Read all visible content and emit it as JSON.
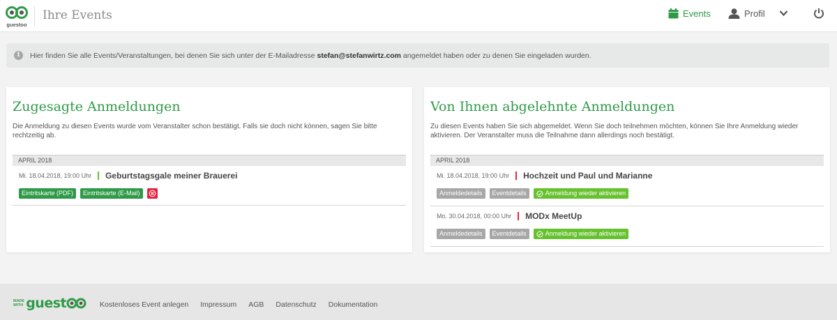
{
  "header": {
    "title": "Ihre Events",
    "logo_text": "guestoo",
    "nav": {
      "events_label": "Events",
      "profil_label": "Profil"
    }
  },
  "alert": {
    "text_before": "Hier finden Sie alle Events/Veranstaltungen, bei denen Sie sich unter der E-Mailadresse ",
    "email": "stefan@stefanwirtz.com",
    "text_after": " angemeldet haben oder zu denen Sie eingeladen wurden."
  },
  "left_card": {
    "title": "Zugesagte Anmeldungen",
    "description": "Die Anmeldung zu diesen Events wurde vom Veranstalter schon bestätigt. Falls sie doch nicht können, sagen Sie bitte rechtzeitig ab.",
    "month": "APRIL 2018",
    "events": [
      {
        "date": "Mi. 18.04.2018, 19:00 Uhr",
        "title": "Geburtstagsgale meiner Brauerei",
        "btn_pdf": "Eintritskarte (PDF)",
        "btn_mail": "Eintritskarte (E-Mail)"
      }
    ]
  },
  "right_card": {
    "title": "Von Ihnen abgelehnte Anmeldungen",
    "description": "Zu diesen Events haben Sie sich abgemeldet. Wenn Sie doch teilnehmen möchten, können Sie Ihre Anmeldung wieder aktivieren. Der Veranstalter muss die Teilnahme dann allerdings noch bestätigt.",
    "month": "APRIL 2018",
    "events": [
      {
        "date": "Mi. 18.04.2018, 19:00 Uhr",
        "title": "Hochzeit und Paul und Marianne",
        "btn_details": "Anmeldedetails",
        "btn_event": "Eventdetails",
        "btn_reactivate": "Anmeldung wieder aktivieren"
      },
      {
        "date": "Mo. 30.04.2018, 00:00 Uhr",
        "title": "MODx MeetUp",
        "btn_details": "Anmeldedetails",
        "btn_event": "Eventdetails",
        "btn_reactivate": "Anmeldung wieder aktivieren"
      }
    ]
  },
  "footer": {
    "made_with_1": "MADE",
    "made_with_2": "WITH",
    "logo_word": "guest",
    "links": [
      "Kostenloses Event anlegen",
      "Impressum",
      "AGB",
      "Datenschutz",
      "Dokumentation"
    ]
  },
  "colors": {
    "brand_green": "#2e9a47",
    "lime": "#66c12e",
    "danger_red": "#e8213d",
    "grey_button": "#a7a7a7"
  },
  "icons": [
    "guestoo-logo-icon",
    "calendar-icon",
    "user-icon",
    "chevron-down-icon",
    "power-icon",
    "info-icon",
    "cancel-circle-icon",
    "check-circle-icon"
  ]
}
